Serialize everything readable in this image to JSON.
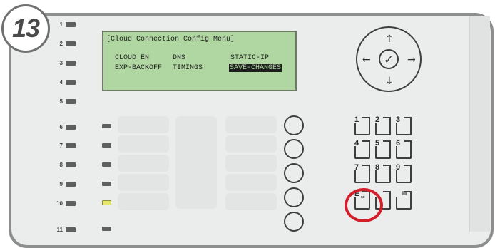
{
  "step": {
    "number": "13"
  },
  "status_leds": [
    {
      "label": "1"
    },
    {
      "label": "2"
    },
    {
      "label": "3"
    },
    {
      "label": "4"
    },
    {
      "label": "5"
    },
    {
      "label": "6"
    },
    {
      "label": "7"
    },
    {
      "label": "8"
    },
    {
      "label": "9"
    },
    {
      "label": "10"
    },
    {
      "label": "11"
    }
  ],
  "lcd": {
    "title": "[Cloud Connection Config Menu]",
    "items": [
      {
        "label": "CLOUD EN",
        "selected": false
      },
      {
        "label": "DNS",
        "selected": false
      },
      {
        "label": "STATIC-IP",
        "selected": false
      },
      {
        "label": "EXP-BACKOFF",
        "selected": false
      },
      {
        "label": "TIMINGS",
        "selected": false
      },
      {
        "label": "SAVE-CHANGES",
        "selected": true
      }
    ]
  },
  "nav": {
    "up": "↑",
    "down": "↓",
    "left": "←",
    "right": "→",
    "ok": "✓"
  },
  "keypad": {
    "keys": [
      "1",
      "2",
      "3",
      "4",
      "5",
      "6",
      "7",
      "8",
      "9"
    ],
    "esc": {
      "main": "E",
      "sub": "sc"
    },
    "help_icon": "book-icon"
  },
  "colors": {
    "highlight": "#d41f2a",
    "lcd_background": "#b0d6a2",
    "active_led": "#e6e86a"
  }
}
